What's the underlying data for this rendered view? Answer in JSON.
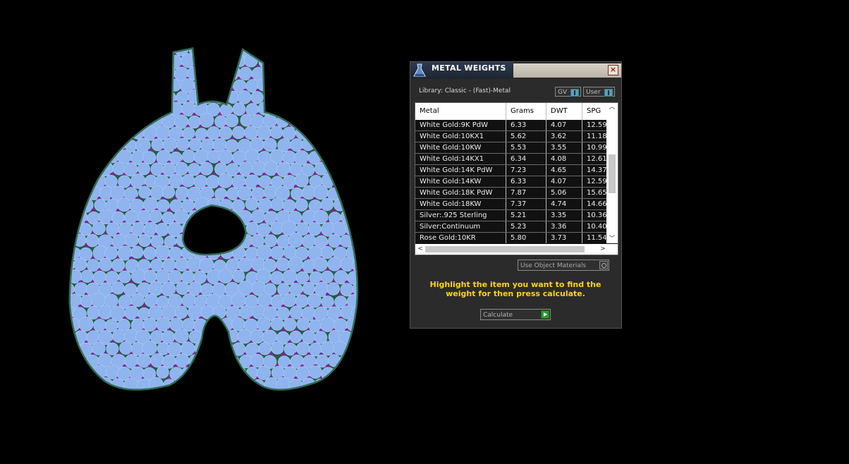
{
  "panel": {
    "title": "METAL WEIGHTS",
    "close_label": "×",
    "library_label": "Library: Classic - (Fast)-Metal",
    "toggle_gv": "GV",
    "toggle_user": "User",
    "table": {
      "headers": [
        "Metal",
        "Grams",
        "DWT",
        "SPG"
      ],
      "rows": [
        [
          "White Gold:9K PdW",
          "6.33",
          "4.07",
          "12.59"
        ],
        [
          "White Gold:10KX1",
          "5.62",
          "3.62",
          "11.18"
        ],
        [
          "White Gold:10KW",
          "5.53",
          "3.55",
          "10.99"
        ],
        [
          "White Gold:14KX1",
          "6.34",
          "4.08",
          "12.61"
        ],
        [
          "White Gold:14K PdW",
          "7.23",
          "4.65",
          "14.37"
        ],
        [
          "White Gold:14KW",
          "6.33",
          "4.07",
          "12.59"
        ],
        [
          "White Gold:18K PdW",
          "7.87",
          "5.06",
          "15.65"
        ],
        [
          "White Gold:18KW",
          "7.37",
          "4.74",
          "14.66"
        ],
        [
          "Silver:.925 Sterling",
          "5.21",
          "3.35",
          "10.36"
        ],
        [
          "Silver:Continuum",
          "5.23",
          "3.36",
          "10.40"
        ],
        [
          "Rose Gold:10KR",
          "5.80",
          "3.73",
          "11.54"
        ]
      ]
    },
    "materials_dropdown": "Use Object Materials",
    "hint": "Highlight the item you want to find the weight for then press calculate.",
    "calculate_label": "Calculate"
  },
  "colors": {
    "gem_fill": "#8fb4ee",
    "prong": "#7a2a8e",
    "metal_edge": "#2e6b52",
    "hint_text": "#ffd21a",
    "background": "#000000"
  }
}
